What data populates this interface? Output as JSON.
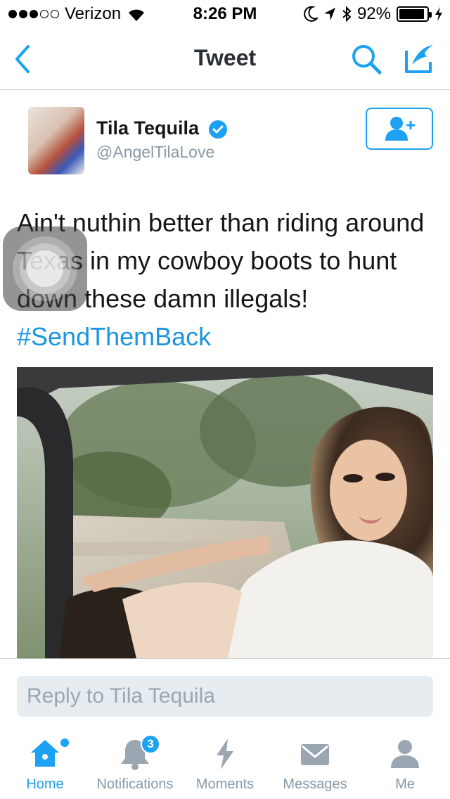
{
  "status_bar": {
    "carrier": "Verizon",
    "time": "8:26 PM",
    "battery": "92%",
    "battery_level": 0.92,
    "signal_bars": 3,
    "signal_total": 5
  },
  "nav": {
    "title": "Tweet",
    "back_icon": "chevron-left-icon",
    "search_icon": "search-icon",
    "compose_icon": "compose-tweet-icon"
  },
  "tweet": {
    "display_name": "Tila Tequila",
    "handle": "@AngelTilaLove",
    "verified": true,
    "text": "Ain't nuthin better than riding around Texas in my cowboy boots to hunt down these damn illegals!",
    "hashtag": "#SendThemBack",
    "follow_icon": "add-user-icon"
  },
  "reply": {
    "placeholder": "Reply to Tila Tequila"
  },
  "tabs": [
    {
      "label": "Home",
      "icon": "home-icon",
      "active": true,
      "has_new": true
    },
    {
      "label": "Notifications",
      "icon": "bell-icon",
      "badge": "3"
    },
    {
      "label": "Moments",
      "icon": "lightning-icon"
    },
    {
      "label": "Messages",
      "icon": "envelope-icon"
    },
    {
      "label": "Me",
      "icon": "person-icon"
    }
  ],
  "colors": {
    "accent": "#1da1f2",
    "hashtag": "#1b95e0",
    "secondary_text": "#8899a6"
  }
}
